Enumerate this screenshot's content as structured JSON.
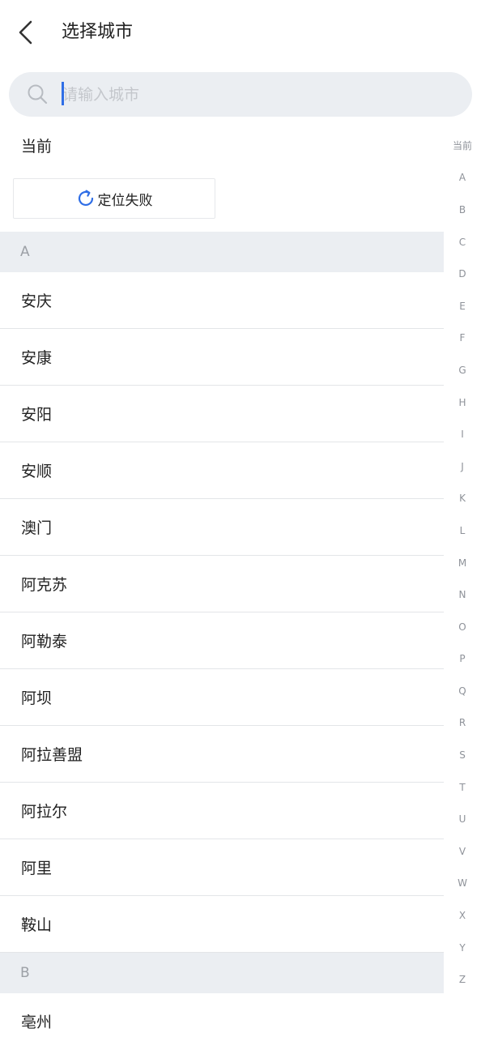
{
  "header": {
    "title": "选择城市"
  },
  "search": {
    "placeholder": "请输入城市",
    "value": ""
  },
  "current": {
    "label": "当前",
    "locate_text": "定位失败"
  },
  "colors": {
    "accent": "#2f6ee6",
    "section_bg": "#ebeef2",
    "index_text": "#8e9299"
  },
  "icons": {
    "back": "chevron-left-icon",
    "search": "search-icon",
    "refresh": "refresh-icon"
  },
  "sections": [
    {
      "letter": "A",
      "cities": [
        "安庆",
        "安康",
        "安阳",
        "安顺",
        "澳门",
        "阿克苏",
        "阿勒泰",
        "阿坝",
        "阿拉善盟",
        "阿拉尔",
        "阿里",
        "鞍山"
      ]
    },
    {
      "letter": "B",
      "cities": [
        "亳州"
      ]
    }
  ],
  "index": [
    "当前",
    "A",
    "B",
    "C",
    "D",
    "E",
    "F",
    "G",
    "H",
    "I",
    "J",
    "K",
    "L",
    "M",
    "N",
    "O",
    "P",
    "Q",
    "R",
    "S",
    "T",
    "U",
    "V",
    "W",
    "X",
    "Y",
    "Z"
  ]
}
